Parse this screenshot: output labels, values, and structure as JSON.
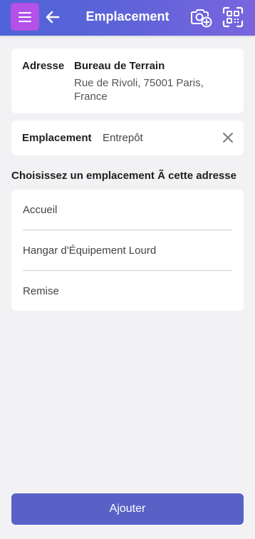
{
  "header": {
    "title": "Emplacement",
    "menu_icon": "hamburger-menu-icon",
    "back_icon": "arrow-left-icon",
    "camera_icon": "camera-add-icon",
    "scan_icon": "qr-scan-icon",
    "colors": {
      "gradient_start": "#4f63d8",
      "gradient_end": "#7a64de",
      "menu_button": "#b451e6"
    }
  },
  "address_card": {
    "label": "Adresse",
    "name": "Bureau de Terrain",
    "line": "Rue de Rivoli, 75001 Paris, France"
  },
  "location_card": {
    "label": "Emplacement",
    "value": "Entrepôt",
    "clear_icon": "close-icon"
  },
  "choose_section": {
    "title": "Choisissez un emplacement Ã  cette adresse",
    "items": [
      {
        "label": "Accueil"
      },
      {
        "label": "Hangar d'Équipement Lourd"
      },
      {
        "label": "Remise"
      }
    ]
  },
  "footer": {
    "add_label": "Ajouter",
    "button_color": "#5761c6"
  }
}
